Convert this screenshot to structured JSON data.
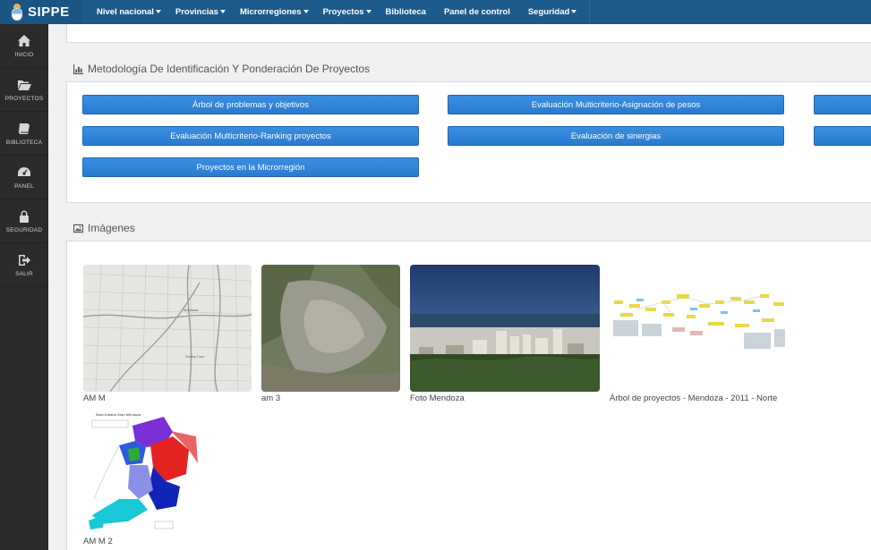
{
  "brand": {
    "name": "SIPPE"
  },
  "nav": [
    {
      "label": "Nivel nacional",
      "caret": true
    },
    {
      "label": "Provincias",
      "caret": true
    },
    {
      "label": "Microrregiones",
      "caret": true
    },
    {
      "label": "Proyectos",
      "caret": true
    },
    {
      "label": "Biblioteca",
      "caret": false
    },
    {
      "label": "Panel de control",
      "caret": false
    },
    {
      "label": "Seguridad",
      "caret": true
    }
  ],
  "sidebar": [
    {
      "label": "INICIO",
      "icon": "home-icon"
    },
    {
      "label": "PROYECTOS",
      "icon": "folder-open-icon"
    },
    {
      "label": "BIBLIOTECA",
      "icon": "book-icon"
    },
    {
      "label": "PANEL",
      "icon": "dashboard-icon"
    },
    {
      "label": "SEGURIDAD",
      "icon": "lock-icon"
    },
    {
      "label": "SALIR",
      "icon": "logout-icon"
    }
  ],
  "methodology": {
    "title": "Metodología De Identificación Y Ponderación De Proyectos",
    "buttons": [
      "Árbol de problemas y objetivos",
      "Evaluación Multicriterio-Asignación de pesos",
      "",
      "Evaluación Multicriterio-Ranking proyectos",
      "Evaluación de sinergias",
      "",
      "Proyectos en la Microrregión"
    ]
  },
  "images": {
    "title": "Imágenes",
    "items": [
      {
        "caption": "AM M"
      },
      {
        "caption": "am 3"
      },
      {
        "caption": "Foto Mendoza"
      },
      {
        "caption": "Árbol de proyectos - Mendoza - 2011 - Norte"
      },
      {
        "caption": "AM M 2"
      }
    ]
  }
}
